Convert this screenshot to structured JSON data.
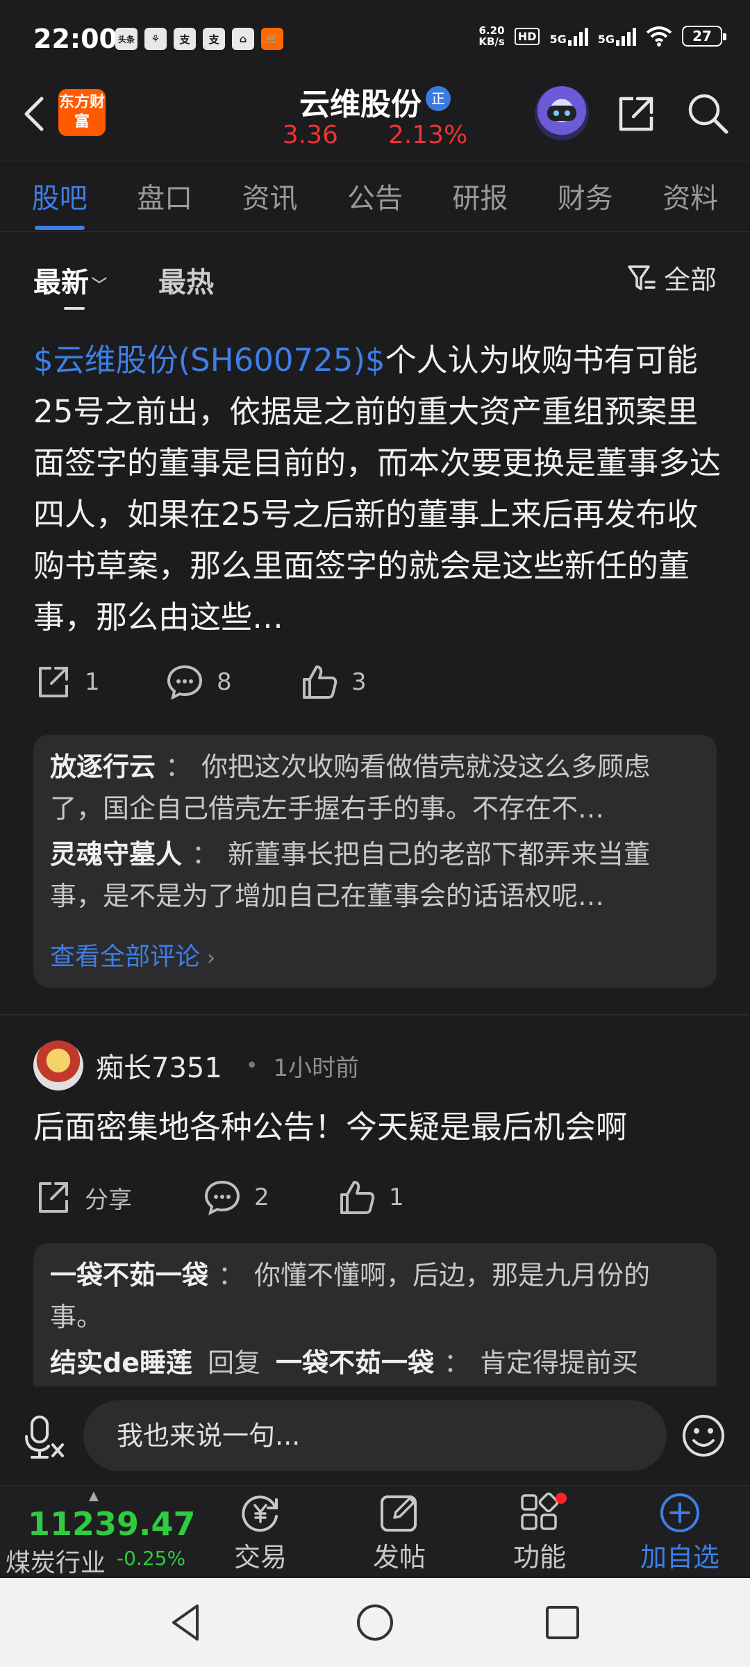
{
  "status_bar": {
    "time": "22:00",
    "apps": [
      "头条",
      "⚘",
      "支",
      "支",
      "⌂",
      "🛒"
    ],
    "net_speed_value": "6.20",
    "net_speed_unit": "KB/s",
    "hd": "HD",
    "sig1": "5G",
    "sig2": "5G",
    "battery": "27"
  },
  "header": {
    "logo_text": "东方财富",
    "stock_name": "云维股份",
    "stock_badge": "正",
    "price": "3.36",
    "change_pct": "2.13%"
  },
  "tabs": [
    "股吧",
    "盘口",
    "资讯",
    "公告",
    "研报",
    "财务",
    "资料"
  ],
  "sort": {
    "latest": "最新",
    "hot": "最热",
    "filter": "全部"
  },
  "post1": {
    "stock_link": "$云维股份(SH600725)$",
    "text": "个人认为收购书有可能25号之前出，依据是之前的重大资产重组预案里面签字的董事是目前的，而本次要更换是董事多达四人，如果在25号之后新的董事上来后再发布收购书草案，那么里面签字的就会是这些新任的董事，那么由这些…",
    "shares": "1",
    "comments": "8",
    "likes": "3",
    "replies": [
      {
        "name": "放逐行云",
        "text": "你把这次收购看做借壳就没这么多顾虑了，国企自己借壳左手握右手的事。不存在不…"
      },
      {
        "name": "灵魂守墓人",
        "text": "新董事长把自己的老部下都弄来当董事，是不是为了增加自己在董事会的话语权呢…"
      }
    ],
    "view_all": "查看全部评论"
  },
  "post2": {
    "author": "痴长7351",
    "time": "1小时前",
    "text": "后面密集地各种公告！今天疑是最后机会啊",
    "share_label": "分享",
    "comments": "2",
    "likes": "1",
    "replies": [
      {
        "name": "一袋不茹一袋",
        "text": "你懂不懂啊，后边，那是九月份的事。"
      },
      {
        "name": "结实de睡莲",
        "reply_word": "回复",
        "target": "一袋不茹一袋",
        "text": "肯定得提前买"
      }
    ]
  },
  "reply_bar": {
    "placeholder": "我也来说一句..."
  },
  "bottom_nav": {
    "index_value": "11239.47",
    "index_name": "煤炭行业",
    "index_change": "-0.25%",
    "trade": "交易",
    "post": "发帖",
    "function": "功能",
    "add_watch": "加自选"
  },
  "colors": {
    "accent": "#3d7fe6",
    "up": "#ee3333",
    "down": "#2ecc40",
    "background": "#1c1c1e"
  }
}
